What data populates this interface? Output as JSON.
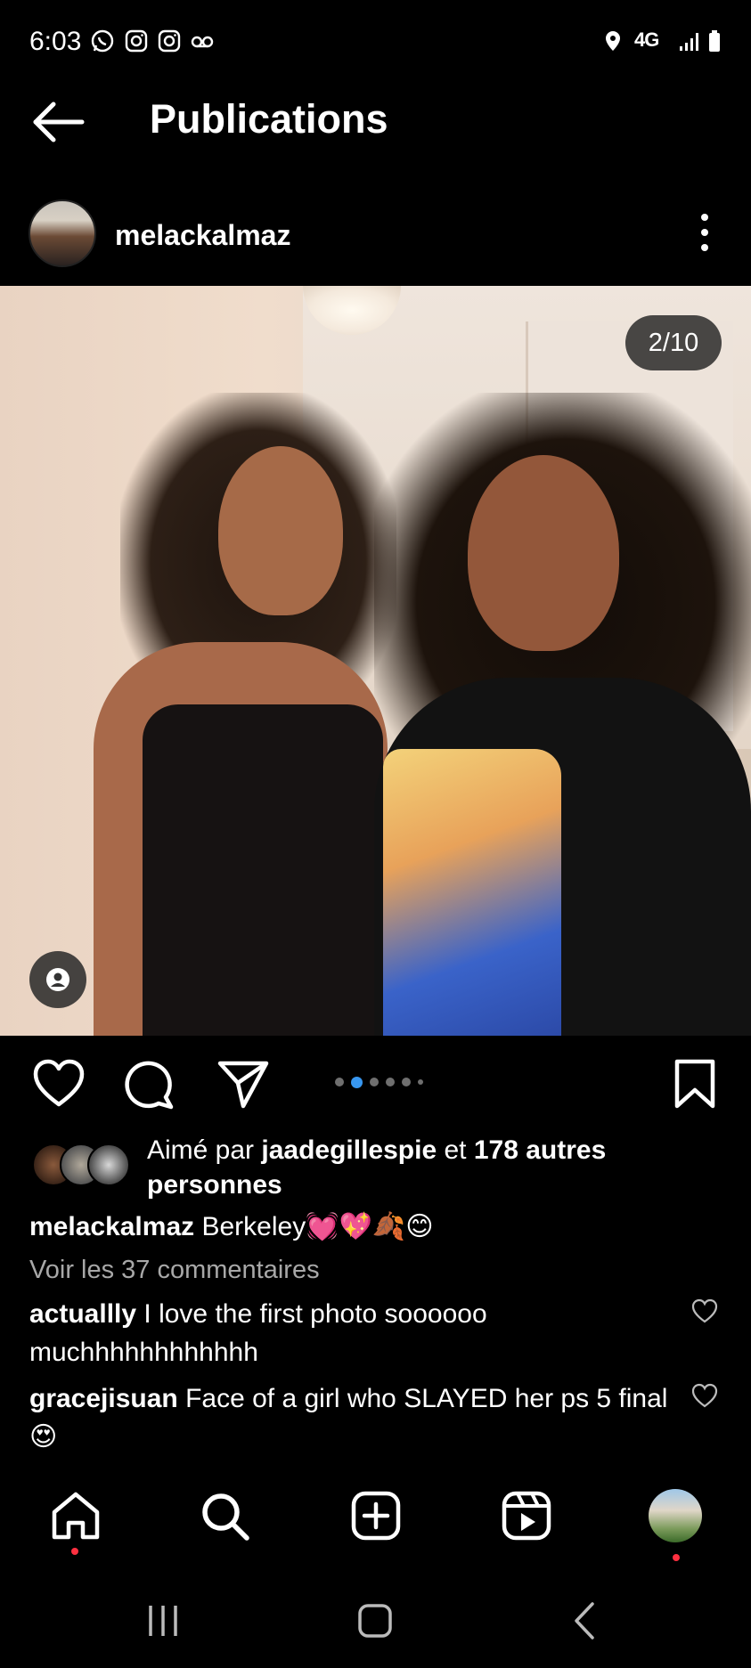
{
  "status_bar": {
    "time": "6:03",
    "network": "4G",
    "icons": [
      "whatsapp-icon",
      "instagram-icon",
      "instagram-icon",
      "voicemail-icon",
      "location-icon",
      "signal-icon",
      "battery-icon"
    ]
  },
  "header": {
    "title": "Publications"
  },
  "post": {
    "username": "melackalmaz",
    "image_counter": "2/10",
    "carousel_dots": 6,
    "carousel_active": 1,
    "likes": {
      "prefix": "Aimé par ",
      "first_liker": "jaadegillespie",
      "middle": " et ",
      "others": "178 autres personnes"
    },
    "caption": {
      "username": "melackalmaz",
      "text": "Berkeley💓💖🍂😊"
    },
    "view_comments": "Voir les 37 commentaires",
    "comments": [
      {
        "username": "actuallly",
        "text": "I love the first photo soooooo muchhhhhhhhhhhh"
      },
      {
        "username": "gracejisuan",
        "text": "Face of a girl who SLAYED her ps 5 final😍"
      }
    ]
  },
  "colors": {
    "background": "#000000",
    "text": "#ffffff",
    "muted": "#a8a8a8",
    "carousel_active": "#3897f0",
    "notification": "#ff3040"
  }
}
